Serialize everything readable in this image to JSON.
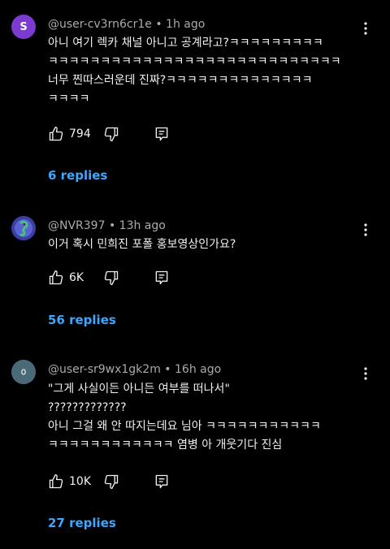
{
  "colors": {
    "background": "#000000",
    "text": "#f1f1f1",
    "meta": "#aaaaaa",
    "link": "#3ea6ff",
    "avatar1": "#7b3bd1",
    "avatar3": "#4a6a78"
  },
  "comments": [
    {
      "author": "@user-cv3rn6cr1e",
      "time": "1h ago",
      "avatar_letter": "S",
      "lines": [
        "아니 여기 렉카 채널 아니고 공계라고?ㅋㅋㅋㅋㅋㅋㅋㅋㅋ",
        "ㅋㅋㅋㅋㅋㅋㅋㅋㅋㅋㅋㅋㅋㅋㅋㅋㅋㅋㅋㅋㅋㅋㅋㅋㅋㅋㅋㅋ",
        "너무 찐따스러운데 진짜?ㅋㅋㅋㅋㅋㅋㅋㅋㅋㅋㅋㅋㅋㅋ",
        "ㅋㅋㅋㅋ"
      ],
      "likes": "794",
      "replies": "6 replies"
    },
    {
      "author": "@NVR397",
      "time": "13h ago",
      "avatar_letter": "",
      "lines": [
        "이거 혹시 민희진 포폴 홍보영상인가요?"
      ],
      "likes": "6K",
      "replies": "56 replies"
    },
    {
      "author": "@user-sr9wx1gk2m",
      "time": "16h ago",
      "avatar_letter": "",
      "lines": [
        "\"그게 사실이든 아니든 여부를 떠나서\"",
        "?????????????",
        "아니 그걸 왜 안 따지는데요 님아 ㅋㅋㅋㅋㅋㅋㅋㅋㅋㅋㅋ",
        "ㅋㅋㅋㅋㅋㅋㅋㅋㅋㅋㅋㅋ 염병 아 개웃기다 진심"
      ],
      "likes": "10K",
      "replies": "27 replies"
    }
  ]
}
